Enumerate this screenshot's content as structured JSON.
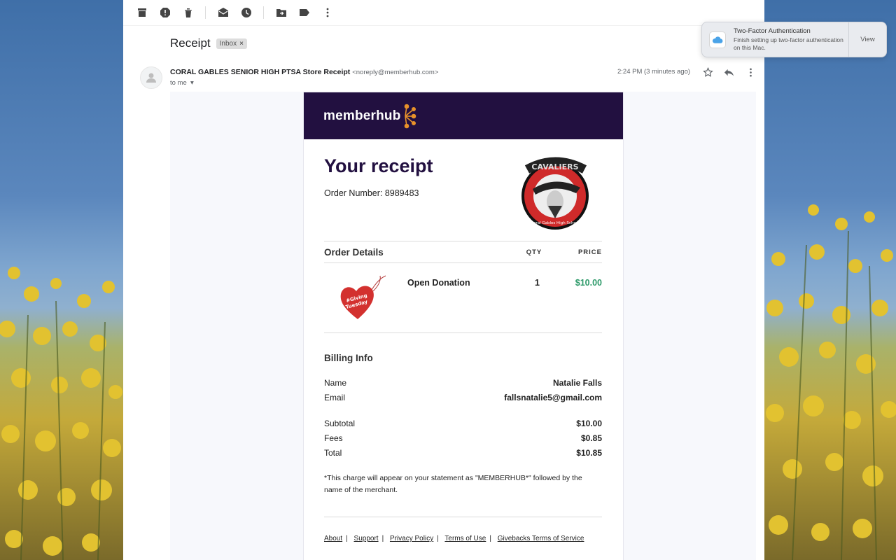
{
  "email": {
    "subject": "Receipt",
    "label": "Inbox",
    "label_close": "×",
    "sender_name": "CORAL GABLES SENIOR HIGH PTSA Store Receipt",
    "sender_email": "<noreply@memberhub.com>",
    "to": "to me",
    "timestamp": "2:24 PM (3 minutes ago)"
  },
  "toolbar": {
    "icons": [
      "archive-icon",
      "report-spam-icon",
      "delete-icon",
      "mark-unread-icon",
      "snooze-icon",
      "move-to-icon",
      "label-icon",
      "more-icon"
    ]
  },
  "receipt": {
    "brand": "memberhub",
    "title": "Your receipt",
    "order_number": "Order Number: 8989483",
    "order_details_heading": "Order Details",
    "qty_header": "QTY",
    "price_header": "PRICE",
    "item": {
      "name": "Open Donation",
      "qty": "1",
      "price": "$10.00",
      "image_text": "#Giving Tuesday"
    },
    "billing_heading": "Billing Info",
    "name_label": "Name",
    "name_value": "Natalie Falls",
    "email_label": "Email",
    "email_value": "fallsnatalie5@gmail.com",
    "subtotal_label": "Subtotal",
    "subtotal_value": "$10.00",
    "fees_label": "Fees",
    "fees_value": "$0.85",
    "total_label": "Total",
    "total_value": "$10.85",
    "note": "*This charge will appear on your statement as \"MEMBERHUB*\" followed by the name of the merchant.",
    "footer": {
      "about": "About",
      "support": "Support",
      "privacy": "Privacy Policy",
      "terms": "Terms of Use",
      "givebacks": "Givebacks Terms of Service",
      "separator": "|"
    },
    "logo_text_top": "CAVALIERS",
    "logo_text_bottom": "Coral Gables High School"
  },
  "notification": {
    "title": "Two-Factor Authentication",
    "message": "Finish setting up two-factor authentication on this Mac.",
    "action": "View"
  },
  "colors": {
    "banner": "#221040",
    "price_green": "#2e9a6a",
    "title_purple": "#221040"
  }
}
